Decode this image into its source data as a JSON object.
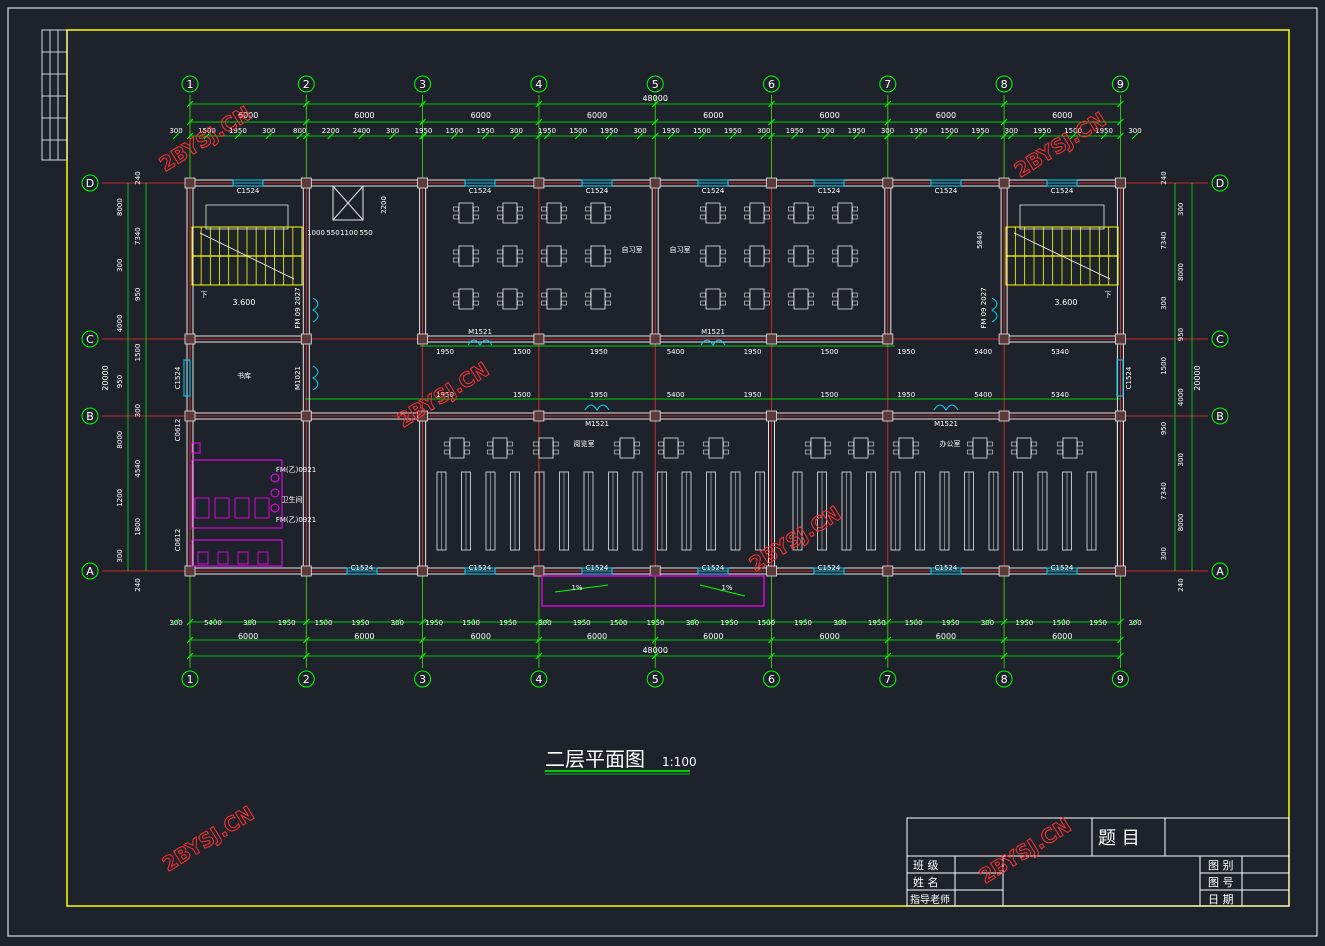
{
  "drawing": {
    "title": "二层平面图",
    "scale": "1:100",
    "watermark": "2BYSJ.CN"
  },
  "axes": {
    "columns": [
      "1",
      "2",
      "3",
      "4",
      "5",
      "6",
      "7",
      "8",
      "9"
    ],
    "rows": [
      "D",
      "C",
      "B",
      "A"
    ]
  },
  "dimensions": {
    "total_length": "48000",
    "bay": "6000",
    "total_depth": "20000",
    "top_detail": [
      "300",
      "1500",
      "1950",
      "300",
      "800",
      "2200",
      "2400",
      "300",
      "1950",
      "1500",
      "1950",
      "300",
      "1950",
      "1500",
      "1950",
      "300",
      "1950",
      "1500",
      "1950",
      "300",
      "1950",
      "1500",
      "1950",
      "300",
      "1950",
      "1500",
      "1950",
      "300",
      "1950",
      "1500",
      "1950",
      "300"
    ],
    "bottom_detail": [
      "300",
      "5400",
      "300",
      "1950",
      "1500",
      "1950",
      "300",
      "1950",
      "1500",
      "1950",
      "300",
      "1950",
      "1500",
      "1950",
      "300",
      "1950",
      "1500",
      "1950",
      "300",
      "1950",
      "1500",
      "1950",
      "300",
      "1950",
      "1500",
      "1950",
      "300"
    ],
    "left_segments": [
      "240",
      "8000",
      "7340",
      "300",
      "950",
      "4000",
      "1500",
      "950",
      "300",
      "8000",
      "4540",
      "1200",
      "1800",
      "300",
      "240"
    ],
    "right_segments": [
      "240",
      "300",
      "7340",
      "8000",
      "300",
      "950",
      "1500",
      "4000",
      "950",
      "300",
      "7340",
      "8000",
      "300",
      "240"
    ],
    "corridor_dims": [
      "1950",
      "1500",
      "1950",
      "5400",
      "1950",
      "1500",
      "1950",
      "5400",
      "5340"
    ],
    "stair_dims": [
      "1000",
      "550",
      "1100",
      "550",
      "2200",
      "5840"
    ]
  },
  "labels": {
    "window": "C1524",
    "door_m": "M1521",
    "door_fm": "FM 09 2027",
    "door_m1021": "M1021",
    "door_c": "C0612",
    "fm_small": "FM(乙)0921",
    "level": "3.600",
    "room_reading": "阅览室",
    "room_library": "书库",
    "room_study": "自习室",
    "room_office": "办公室",
    "room_toilet": "卫生间",
    "slope": "1%",
    "up": "下"
  },
  "title_block": {
    "subject": "题 目",
    "class": "班 级",
    "name": "姓 名",
    "advisor": "指导老师",
    "drawing_name": "图 别",
    "drawing_no": "图 号",
    "date": "日 期"
  },
  "colors": {
    "background": "#1e232b",
    "frame_yellow": "#ffff00",
    "dimension_green": "#00ff00",
    "wall_white": "#e6e6e6",
    "axis_red": "#ff2a2a",
    "text_white": "#ffffff",
    "window_cyan": "#00d7ff",
    "sanitary_magenta": "#ff00ff",
    "stair_yellow": "#ffff00"
  }
}
